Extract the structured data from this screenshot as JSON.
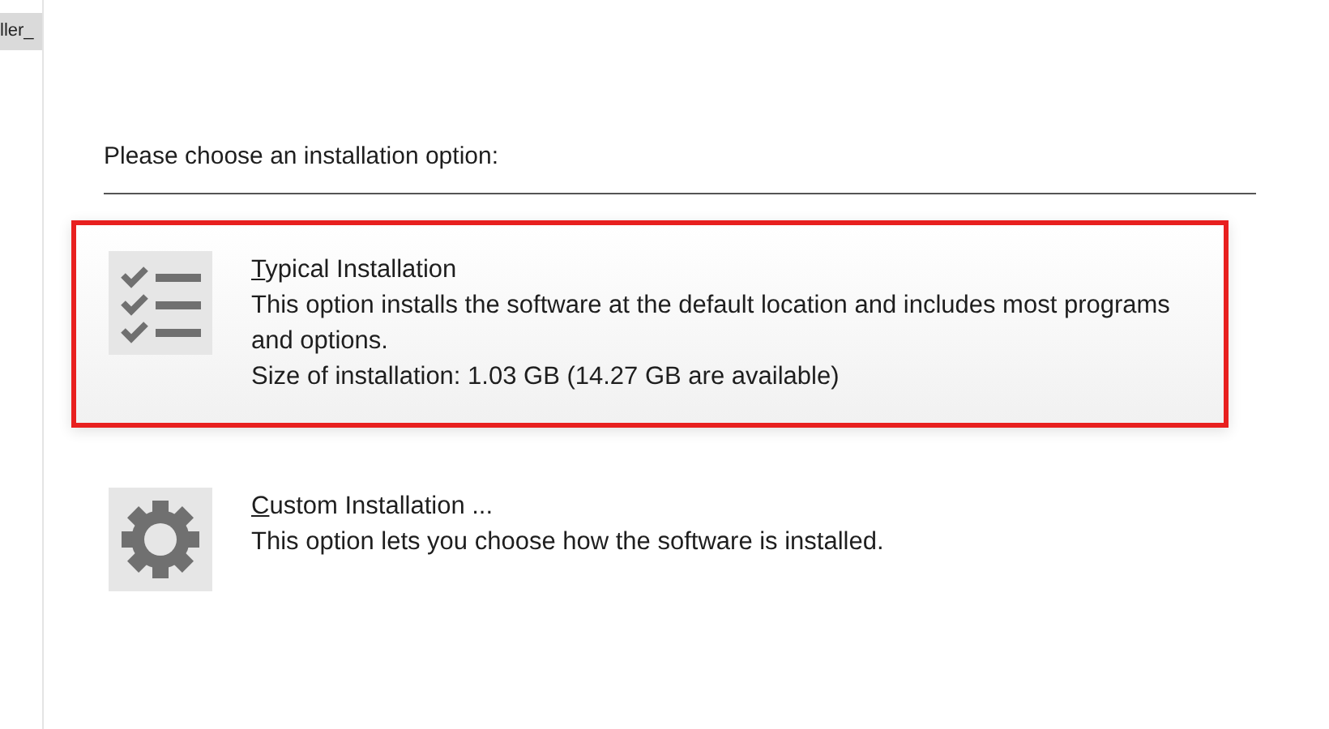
{
  "side_tab": {
    "label": "ller_"
  },
  "heading": "Please choose an installation option:",
  "options": [
    {
      "kind": "checklist",
      "title": "Typical Installation",
      "access_key_underlined": true,
      "selected": true,
      "highlighted": true,
      "lines": [
        "This option installs the software at the default location and includes most programs and options.",
        "Size of installation: 1.03 GB (14.27 GB are available)"
      ]
    },
    {
      "kind": "gear",
      "title": "Custom Installation ...",
      "access_key_underlined": true,
      "selected": false,
      "highlighted": false,
      "lines": [
        "This option lets you choose how the software is installed."
      ]
    }
  ]
}
